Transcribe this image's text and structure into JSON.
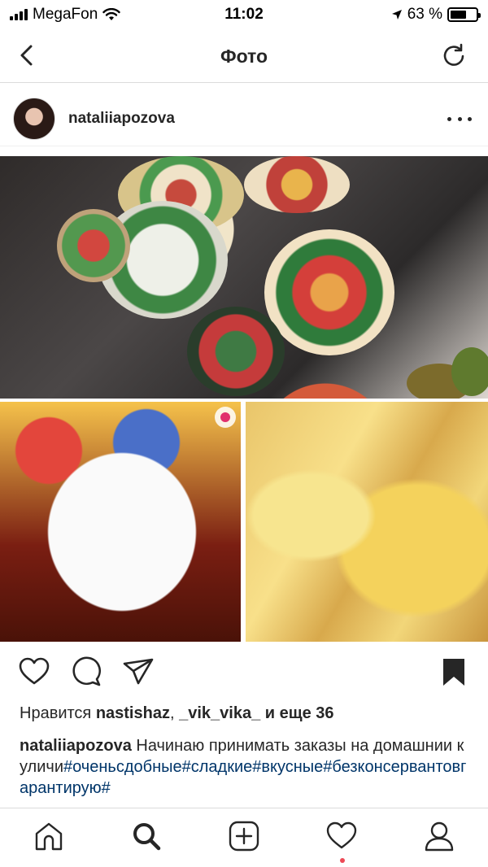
{
  "status_bar": {
    "carrier": "MegaFon",
    "time": "11:02",
    "battery_percent": "63 %",
    "battery_level": 0.63
  },
  "nav": {
    "back_icon": "chevron-left-icon",
    "title": "Фото",
    "refresh_icon": "refresh-icon"
  },
  "post": {
    "username": "nataliiapozova",
    "more_icon": "more-dots-icon",
    "likes": {
      "prefix": "Нравится ",
      "user1": "nastishaz",
      "sep": ", ",
      "user2": "_vik_vika_",
      "suffix": " и еще 36"
    },
    "caption": {
      "author": "nataliiapozova",
      "text": " Начинаю принимать заказы на домашнии куличи",
      "hashtags": "#оченьсдобные#сладкие#вкусные#безконсервантовгарантирую#"
    }
  },
  "actions": {
    "like_icon": "heart-outline-icon",
    "comment_icon": "comment-bubble-icon",
    "share_icon": "paper-plane-icon",
    "save_icon": "bookmark-filled-icon"
  },
  "tabbar": {
    "items": [
      "home-icon",
      "search-icon",
      "add-icon",
      "activity-heart-icon",
      "profile-icon"
    ],
    "active": "search-icon",
    "notification_color": "#ed4956"
  },
  "colors": {
    "text": "#262626",
    "hashtag": "#003569",
    "divider": "#dbdbdb"
  }
}
